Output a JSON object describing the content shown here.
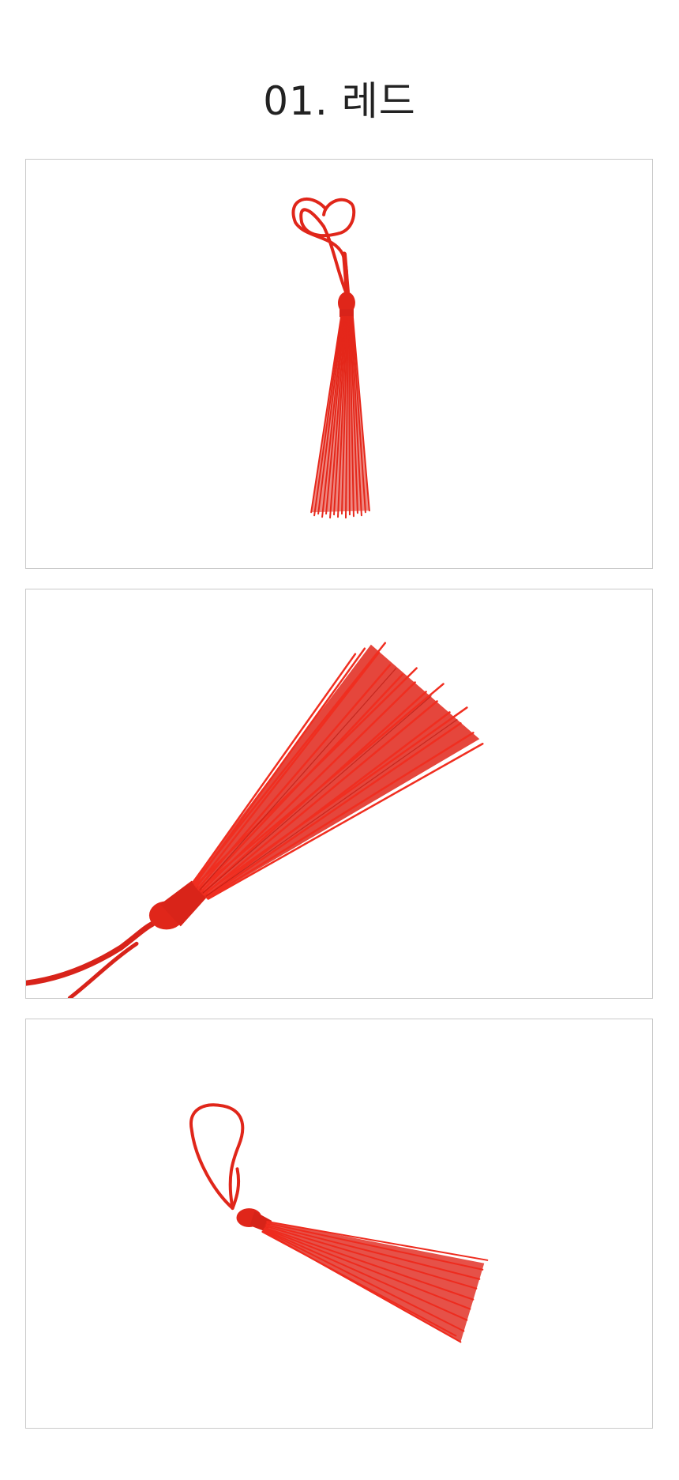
{
  "title": "01. 레드",
  "product_color": "#e0261a",
  "images": [
    {
      "subject": "tassel-front-view"
    },
    {
      "subject": "tassel-closeup-view"
    },
    {
      "subject": "tassel-angled-view"
    }
  ]
}
